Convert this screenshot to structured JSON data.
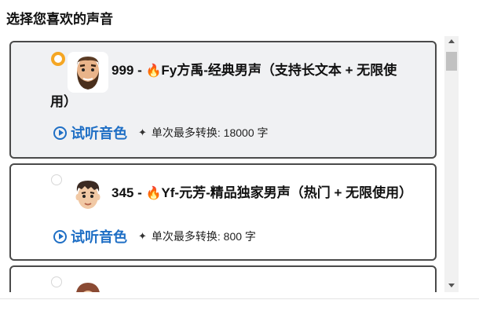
{
  "heading": "选择您喜欢的声音",
  "voices": [
    {
      "id": "999",
      "title_prefix": "999 - ",
      "flame": "🔥",
      "name_line1": "Fy方禹-经典男声（支持长文本 + 无限使",
      "name_line2": "用）",
      "selected": true,
      "listen_label": "试听音色",
      "limit_label": "单次最多转换: 18000 字",
      "avatar": "bearded-man-avatar"
    },
    {
      "id": "345",
      "title_prefix": "345 - ",
      "flame": "🔥",
      "name_line1": "Yf-元芳-精品独家男声（热门 + 无限使用）",
      "selected": false,
      "listen_label": "试听音色",
      "limit_label": "单次最多转换: 800 字",
      "avatar": "young-man-avatar"
    },
    {
      "selected": false,
      "avatar": "woman-avatar"
    }
  ],
  "colors": {
    "accent_blue": "#1f6fc5",
    "radio_selected": "#f5a623",
    "card_border": "#4a4a4a",
    "selected_bg": "#f0f1f3"
  }
}
